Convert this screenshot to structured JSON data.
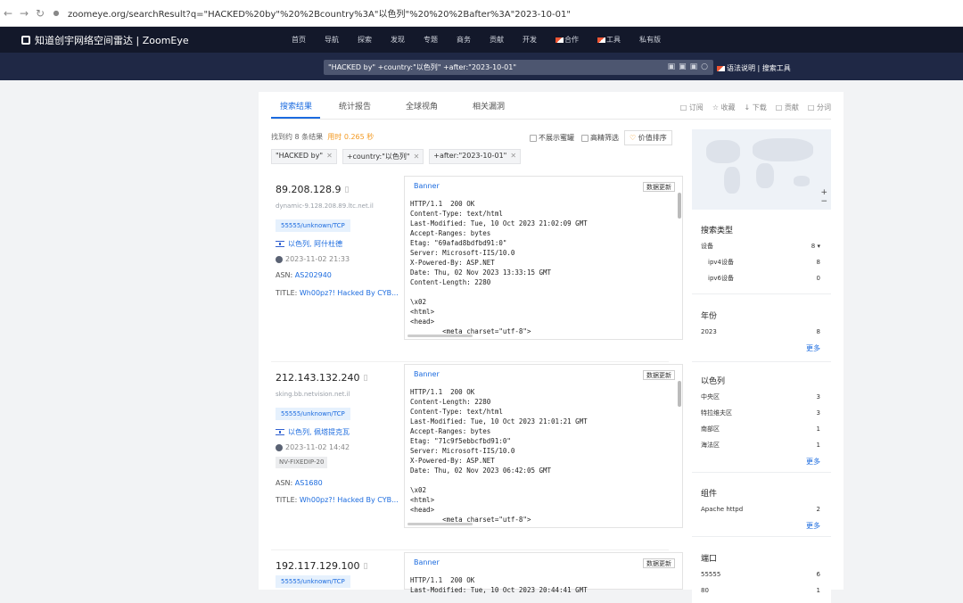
{
  "browser": {
    "url": "zoomeye.org/searchResult?q=\"HACKED%20by\"%20%2Bcountry%3A\"以色列\"%20%20%2Bafter%3A\"2023-10-01\""
  },
  "header": {
    "logo": "知道创宇网络空间雷达 | ZoomEye",
    "nav": [
      "首页",
      "导航",
      "探索",
      "发现",
      "专题",
      "商务",
      "贡献",
      "开发",
      "合作",
      "工具",
      "私有版"
    ]
  },
  "search": {
    "query": "\"HACKED by\" +country:\"以色列\" +after:\"2023-10-01\"",
    "links": "语法说明 | 搜索工具"
  },
  "tabs": [
    "搜索结果",
    "统计报告",
    "全球视角",
    "相关漏洞"
  ],
  "top_actions": [
    "订阅",
    "收藏",
    "下载",
    "贡献",
    "分词"
  ],
  "result": {
    "count": "找到约 8 条结果",
    "time": "用时 0.265 秒"
  },
  "filters": {
    "no_honeypot": "不展示蜜罐",
    "high_precision": "高精筛选",
    "sort": "价值排序"
  },
  "tags": [
    "\"HACKED by\"",
    "+country:\"以色列\"",
    "+after:\"2023-10-01\""
  ],
  "results": [
    {
      "ip": "89.208.128.9",
      "host": "dynamic-9.128.208.89.ltc.net.il",
      "port": "55555/unknown/TCP",
      "location": "以色列, 阿什杜德",
      "date": "2023-11-02 21:33",
      "asn_label": "ASN:",
      "asn": "AS202940",
      "title_label": "TITLE:",
      "title": "Wh00pz?! Hacked By CYB...",
      "banner_tab": "Banner",
      "update": "数据更新",
      "banner": "HTTP/1.1  200 OK\nContent-Type: text/html\nLast-Modified: Tue, 10 Oct 2023 21:02:09 GMT\nAccept-Ranges: bytes\nEtag: \"69afad8bdfbd91:0\"\nServer: Microsoft-IIS/10.0\nX-Powered-By: ASP.NET\nDate: Thu, 02 Nov 2023 13:33:15 GMT\nContent-Length: 2280\n\n\\x02\n<html>\n<head>\n        <meta charset=\"utf-8\">"
    },
    {
      "ip": "212.143.132.240",
      "host": "sking.bb.netvision.net.il",
      "port": "55555/unknown/TCP",
      "location": "以色列, 佩塔提克瓦",
      "date": "2023-11-02 14:42",
      "extra_tag": "NV-FIXEDIP-20",
      "asn_label": "ASN:",
      "asn": "AS1680",
      "title_label": "TITLE:",
      "title": "Wh00pz?! Hacked By CYB...",
      "banner_tab": "Banner",
      "update": "数据更新",
      "banner": "HTTP/1.1  200 OK\nContent-Length: 2280\nContent-Type: text/html\nLast-Modified: Tue, 10 Oct 2023 21:01:21 GMT\nAccept-Ranges: bytes\nEtag: \"71c9f5ebbcfbd91:0\"\nServer: Microsoft-IIS/10.0\nX-Powered-By: ASP.NET\nDate: Thu, 02 Nov 2023 06:42:05 GMT\n\n\\x02\n<html>\n<head>\n        <meta charset=\"utf-8\">"
    },
    {
      "ip": "192.117.129.100",
      "port": "55555/unknown/TCP",
      "banner_tab": "Banner",
      "update": "数据更新",
      "banner": "HTTP/1.1  200 OK\nLast-Modified: Tue, 10 Oct 2023 20:44:41 GMT"
    }
  ],
  "sidebar": {
    "search_type": {
      "title": "搜索类型",
      "rows": [
        {
          "label": "设备",
          "count": "8 ▾"
        },
        {
          "label": "ipv4设备",
          "count": "8",
          "sub": true
        },
        {
          "label": "ipv6设备",
          "count": "0",
          "sub": true
        }
      ]
    },
    "year": {
      "title": "年份",
      "rows": [
        {
          "label": "2023",
          "count": "8"
        }
      ],
      "more": "更多"
    },
    "israel": {
      "title": "以色列",
      "rows": [
        {
          "label": "中央区",
          "count": "3"
        },
        {
          "label": "特拉维夫区",
          "count": "3"
        },
        {
          "label": "南部区",
          "count": "1"
        },
        {
          "label": "海法区",
          "count": "1"
        }
      ],
      "more": "更多"
    },
    "component": {
      "title": "组件",
      "rows": [
        {
          "label": "Apache httpd",
          "count": "2"
        }
      ],
      "more": "更多"
    },
    "port": {
      "title": "端口",
      "rows": [
        {
          "label": "55555",
          "count": "6"
        },
        {
          "label": "80",
          "count": "1"
        }
      ]
    }
  }
}
